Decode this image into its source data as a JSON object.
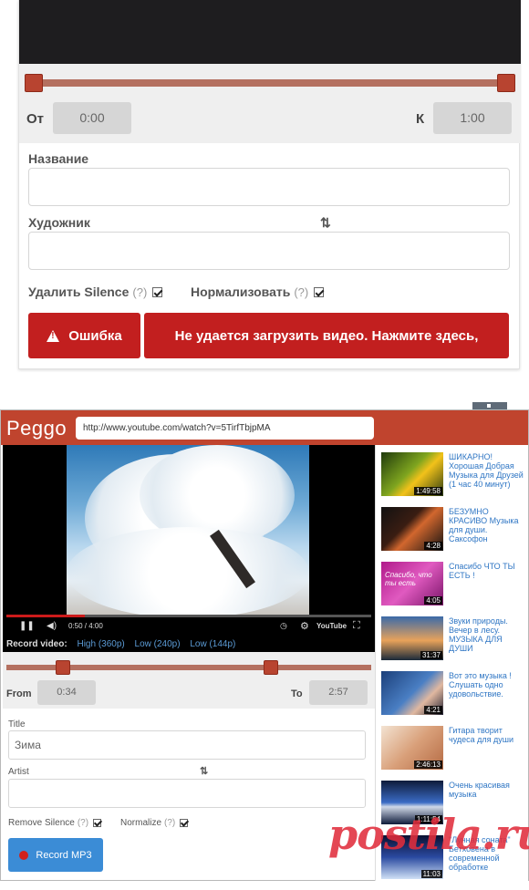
{
  "top": {
    "from_label": "От",
    "from_time": "0:00",
    "to_label": "К",
    "to_time": "1:00",
    "title_label": "Название",
    "artist_label": "Художник",
    "swap_icon": "⇅",
    "remove_silence_label": "Удалить Silence",
    "normalize_label": "Нормализовать",
    "hint": "(?)",
    "error_label": "Ошибка",
    "error_message": "Не удается загрузить видео. Нажмите здесь,"
  },
  "peggo": {
    "logo": "Peggo",
    "url": "http://www.youtube.com/watch?v=5TirfTbjpMA",
    "player_time": "0:50 / 4:00",
    "youtube_label": "YouTube",
    "record_video_label": "Record video:",
    "qualities": [
      "High (360p)",
      "Low (240p)",
      "Low (144p)"
    ],
    "from_label": "From",
    "from_time": "0:34",
    "to_label": "To",
    "to_time": "2:57",
    "title_label": "Title",
    "title_value": "Зима",
    "artist_label": "Artist",
    "artist_value": "",
    "swap_icon": "⇅",
    "remove_silence_label": "Remove Silence",
    "normalize_label": "Normalize",
    "hint": "(?)",
    "record_button": "Record MP3",
    "related": [
      {
        "title": "ШИКАРНО! Хорошая Добрая Музыка для Друзей (1 час 40 минут)",
        "duration": "1:49:58"
      },
      {
        "title": "БЕЗУМНО КРАСИВО Музыка для души. Саксофон",
        "duration": "4:28"
      },
      {
        "title": "Спасибо ЧТО ТЫ ЕСТЬ !",
        "duration": "4:05",
        "thumb_text": "Спасибо, что ты есть"
      },
      {
        "title": "Звуки природы. Вечер в лесу. МУЗЫКА ДЛЯ ДУШИ",
        "duration": "31:37"
      },
      {
        "title": "Вот это музыка ! Слушать одно удовольствие.",
        "duration": "4:21"
      },
      {
        "title": "Гитара творит чудеса для души",
        "duration": "2:46:13"
      },
      {
        "title": "Очень красивая музыка",
        "duration": "1:11:54"
      },
      {
        "title": "\"Лунная соната\" Бетховена в современной обработке",
        "duration": "11:03"
      }
    ]
  },
  "watermark": "postila.ru"
}
